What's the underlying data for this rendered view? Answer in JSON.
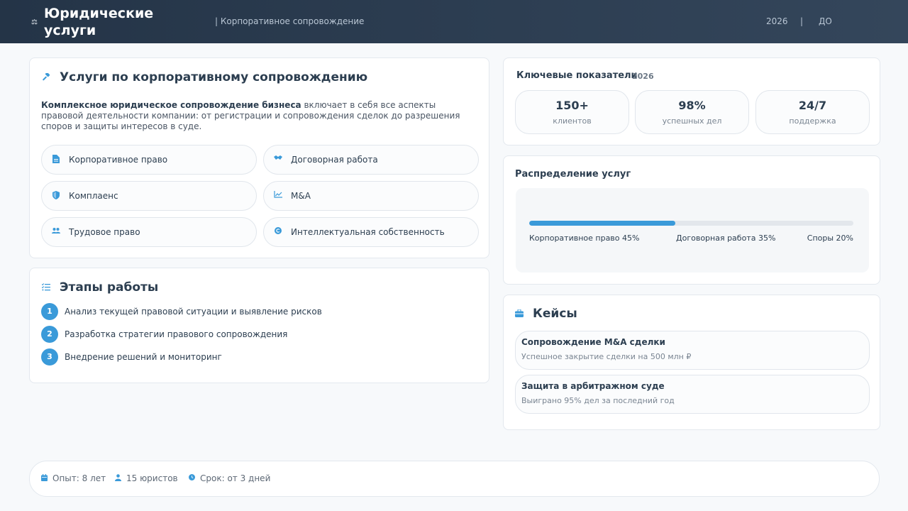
{
  "header": {
    "brand_icon": "⚖",
    "brand": "Юридические услуги",
    "subtitle": "| Корпоративное сопровождение",
    "year": "2026",
    "separator": "|",
    "to": "ДО"
  },
  "services": {
    "icon": "gavel-icon",
    "title": "Услуги по корпоративному сопровождению",
    "desc_bold": "Комплексное юридическое сопровождение бизнеса",
    "desc_rest": " включает в себя все аспекты правовой деятельности компании: от регистрации и сопровождения сделок до разрешения споров и защиты интересов в суде.",
    "items": [
      {
        "label": "Корпоративное право",
        "icon": "document-icon"
      },
      {
        "label": "Договорная работа",
        "icon": "handshake-icon"
      },
      {
        "label": "Комплаенс",
        "icon": "shield-icon"
      },
      {
        "label": "M&A",
        "icon": "chart-line-icon"
      },
      {
        "label": "Трудовое право",
        "icon": "users-icon"
      },
      {
        "label": "Интеллектуальная собственность",
        "icon": "copyright-icon"
      }
    ]
  },
  "steps": {
    "icon": "list-check-icon",
    "title": "Этапы работы",
    "items": [
      {
        "num": "1",
        "text": "Анализ текущей правовой ситуации и выявление рисков"
      },
      {
        "num": "2",
        "text": "Разработка стратегии правового сопровождения"
      },
      {
        "num": "3",
        "text": "Внедрение решений и мониторинг"
      }
    ]
  },
  "kpi": {
    "title": "Ключевые показатели",
    "year": "2026",
    "items": [
      {
        "value": "150+",
        "label": "клиентов"
      },
      {
        "value": "98%",
        "label": "успешных дел"
      },
      {
        "value": "24/7",
        "label": "поддержка"
      }
    ]
  },
  "distribution": {
    "title": "Распределение услуг",
    "progress_fraction": 0.45,
    "labels": [
      "Корпоративное право 45%",
      "Договорная работа 35%",
      "Споры 20%"
    ],
    "accent_color": "#3a9ad9"
  },
  "cases": {
    "icon": "briefcase-icon",
    "title": "Кейсы",
    "items": [
      {
        "title": "Сопровождение M&A сделки",
        "sub": "Успешное закрытие сделки на 500 млн ₽"
      },
      {
        "title": "Защита в арбитражном суде",
        "sub": "Выиграно 95% дел за последний год"
      }
    ]
  },
  "footer": {
    "items": [
      {
        "icon": "calendar-icon",
        "text": "Опыт: 8 лет"
      },
      {
        "icon": "user-icon",
        "text": "15 юристов"
      },
      {
        "icon": "clock-icon",
        "text": "Срок: от 3 дней"
      }
    ]
  }
}
